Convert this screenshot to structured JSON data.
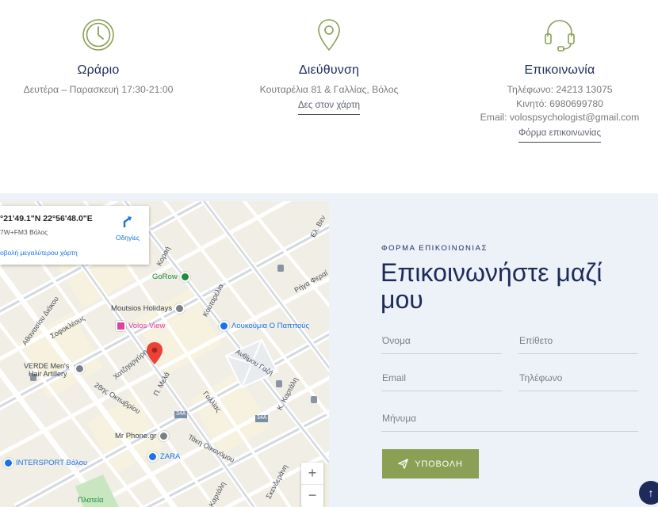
{
  "info": {
    "hours": {
      "icon": "clock-icon",
      "title": "Ωράριο",
      "text": "Δευτέρα – Παρασκευή 17:30-21:00"
    },
    "address": {
      "icon": "location-pin-icon",
      "title": "Διεύθυνση",
      "text": "Κουταρέλια 81 & Γαλλίας, Βόλος",
      "link": "Δες στον χάρτη"
    },
    "contact": {
      "icon": "headset-icon",
      "title": "Επικοινωνία",
      "phone": "Τηλέφωνο: 24213 13075",
      "mobile": "Κινητό: 6980699780",
      "email": "Email: volospsychologist@gmail.com",
      "link": "Φόρμα επικοινωνίας"
    }
  },
  "map": {
    "coords": "°21'49.1\"N 22°56'48.0\"E",
    "plus_code": "7W+FM3 Βόλος",
    "bigger_map": "οβολή μεγαλύτερου χάρτη",
    "directions": "Οδηγίες",
    "zoom_in": "+",
    "zoom_out": "−",
    "pois": [
      {
        "name": "GoRow",
        "color": "#1e8e3e"
      },
      {
        "name": "Moutsios Holidays",
        "color": "#7b7f87"
      },
      {
        "name": "Volos View",
        "color": "#e040a0"
      },
      {
        "name": "Λουκούμια Ο Παππούς",
        "color": "#1a73e8"
      },
      {
        "name": "VERDE Men's",
        "color": "#7b7f87"
      },
      {
        "name": "Hair Artillery",
        "color": "#7b7f87"
      },
      {
        "name": "Mr Phone.gr",
        "color": "#7b7f87"
      },
      {
        "name": "ZARA",
        "color": "#1a73e8"
      },
      {
        "name": "INTERSPORT Βόλου",
        "color": "#1a73e8"
      },
      {
        "name": "Πλατεία",
        "color": "#1e8e3e"
      }
    ],
    "streets": [
      "Κοραή",
      "Κουταρέλια",
      "Ρήγα Φεραί",
      "Ανθίμου Γαζή",
      "Γαλλίας",
      "Κ. Καρτάλη",
      "Π. Μελά",
      "28ης Οκτωβρίου",
      "Χατζηαργύρη",
      "Σοφοκλέους",
      "Αθανασίου Διάκου",
      "Τάκη Οικονόμου",
      "Ελ. Βεν",
      "Καρτάλη",
      "Σκενδεράνη",
      "34Α",
      "34Α"
    ]
  },
  "form": {
    "kicker": "ΦΟΡΜΑ ΕΠΙΚΟΙΝΩΝΙΑΣ",
    "heading": "Επικοινωνήστε μαζί μου",
    "name_placeholder": "Όνομα",
    "lastname_placeholder": "Επίθετο",
    "email_placeholder": "Email",
    "phone_placeholder": "Τηλέφωνο",
    "message_placeholder": "Μήνυμα",
    "submit_label": "ΥΠΟΒΟΛΗ"
  },
  "scroll_top": "↑"
}
